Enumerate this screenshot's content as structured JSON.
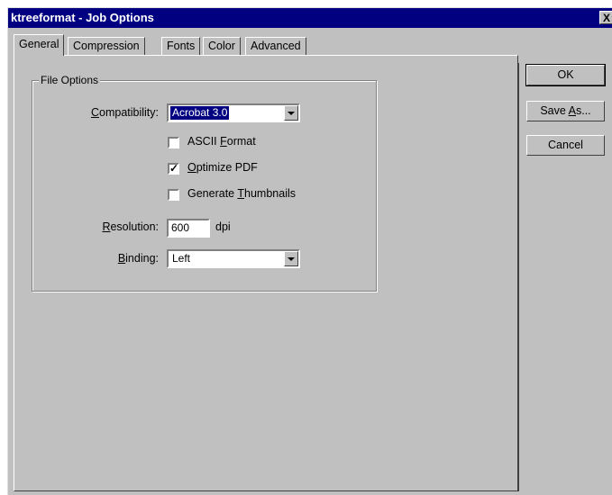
{
  "window": {
    "title": "ktreeformat - Job Options",
    "close_glyph": "X"
  },
  "tabs": [
    {
      "label": "General"
    },
    {
      "label": "Compression"
    },
    {
      "label": "Fonts"
    },
    {
      "label": "Color"
    },
    {
      "label": "Advanced"
    }
  ],
  "file_options": {
    "legend": "File Options",
    "compatibility": {
      "label_pre": "",
      "label_u": "C",
      "label_post": "ompatibility:",
      "value": "Acrobat 3.0"
    },
    "ascii_format": {
      "label_pre": "ASCII ",
      "label_u": "F",
      "label_post": "ormat",
      "checked": false
    },
    "optimize_pdf": {
      "label_pre": "",
      "label_u": "O",
      "label_post": "ptimize PDF",
      "checked": true,
      "check_glyph": "✓"
    },
    "generate_thumbnails": {
      "label_pre": "Generate ",
      "label_u": "T",
      "label_post": "humbnails",
      "checked": false
    },
    "resolution": {
      "label_pre": "",
      "label_u": "R",
      "label_post": "esolution:",
      "value": "600",
      "unit": "dpi"
    },
    "binding": {
      "label_pre": "",
      "label_u": "B",
      "label_post": "inding:",
      "value": "Left"
    }
  },
  "buttons": {
    "ok": {
      "label": "OK"
    },
    "save_as": {
      "label_pre": "Save ",
      "label_u": "A",
      "label_post": "s..."
    },
    "cancel": {
      "label": "Cancel"
    }
  }
}
